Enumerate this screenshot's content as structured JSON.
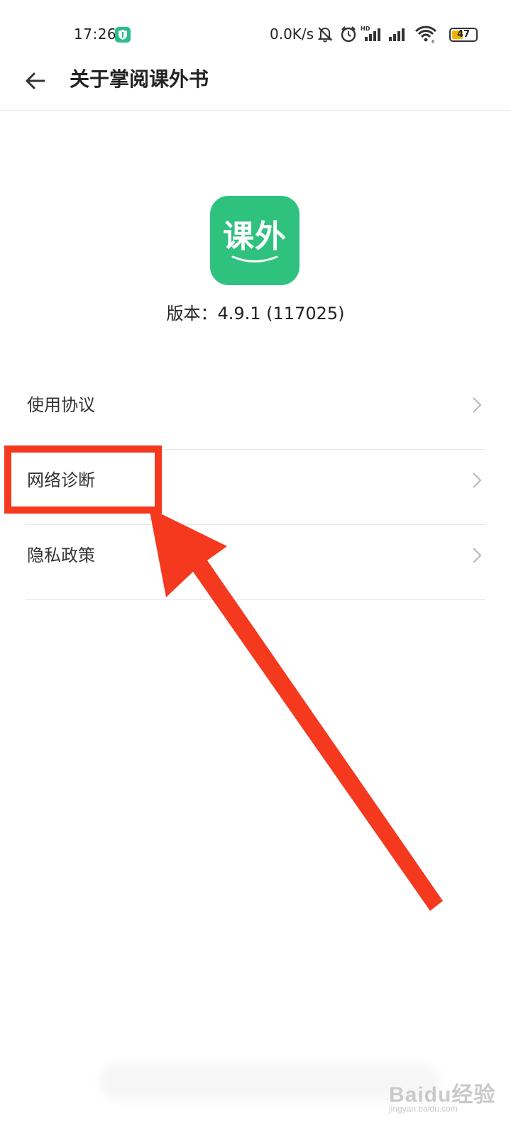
{
  "status_bar": {
    "time": "17:26",
    "net_speed": "0.0K/s",
    "battery": "47",
    "icons": [
      "shield-icon",
      "mute-icon",
      "alarm-icon",
      "hd-signal-icon",
      "signal-icon",
      "wifi-icon",
      "battery-icon"
    ]
  },
  "header": {
    "back_icon": "arrow-left-icon",
    "title": "关于掌阅课外书"
  },
  "app": {
    "icon_text": "课外",
    "icon_color": "#2ec27e",
    "version": "版本：4.9.1 (117025)"
  },
  "menu": {
    "items": [
      {
        "label": "使用协议",
        "icon": "chevron-right-icon"
      },
      {
        "label": "网络诊断",
        "icon": "chevron-right-icon"
      },
      {
        "label": "隐私政策",
        "icon": "chevron-right-icon"
      }
    ]
  },
  "annotation": {
    "color": "#f4391f",
    "highlighted_item": "网络诊断"
  },
  "watermark": {
    "brand": "Baidu经验",
    "site": "jingyan.baidu.com"
  }
}
